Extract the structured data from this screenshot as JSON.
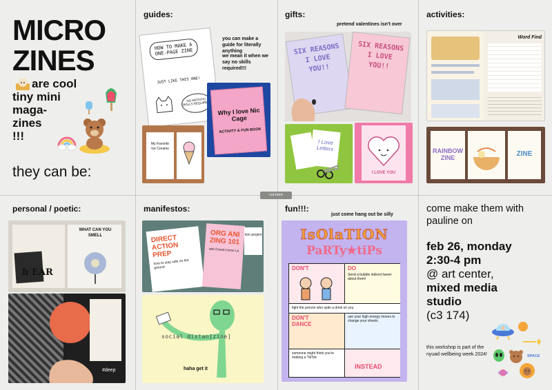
{
  "panels": {
    "title": {
      "headline_line1": "MICRO",
      "headline_line2": "ZINES",
      "line_a": "are cool",
      "line_b": "tiny mini",
      "line_c": "maga-",
      "line_d": "zines",
      "line_e": "!!!",
      "they_can_be": "they can be:"
    },
    "guides": {
      "title": "guides:",
      "note_line1": "you can make a guide for literally anything",
      "note_line2": "we mean it when we say no skills required!!!",
      "zine1_title": "HOW TO MAKE A ONE-PAGE ZINE",
      "zine1_sub": "JUST LIKE THIS ONE!",
      "zine1_bubble": "NO ARTISTIC SKILLS REQUIRED!",
      "zine2_title": "Why I love Nic Cage",
      "zine2_sub": "ACTIVITY & FUN BOOK",
      "zine3_title": "My Favorite Ice Creams"
    },
    "gifts": {
      "title": "gifts:",
      "note": "pretend valentines isn't over",
      "zine_text": "SIX REASONS I LOVE YOU!!",
      "zine2_text": "I Love Letters",
      "zine3_text": "I LOVE YOU"
    },
    "activities": {
      "title": "activities:",
      "wordfind": "Word Find",
      "zine_label1": "RAINBOW ZINE",
      "zine_label2": "ZINE"
    },
    "personal": {
      "title": "personal / poetic:",
      "collage_text1": "WHAT CAN YOU SMELL",
      "collage_text2": "h EAR",
      "hashtag": "#deep"
    },
    "manifestos": {
      "title": "manifestos:",
      "zine1_title": "DIRECT ACTION PREP",
      "zine1_sub": "how to stay safe on the ground",
      "zine2_title": "ORG ANI ZING 101",
      "zine2_sub": "with Crowd Cmmo LA",
      "zine3_title": "rion project",
      "social": "social distan[zine]",
      "caption": "haha get it"
    },
    "fun": {
      "title": "fun!!!:",
      "note": "just come hang out be silly",
      "poster_line1": "IsOlaTION",
      "poster_line2": "PaRTy★tiPs",
      "cell_dont1": "DON'T",
      "cell_do": "DO",
      "cell_do_text": "Send a bubble indirect tweet about them!",
      "cell_fight": "fight the person who spits a drink on you",
      "cell_dont2": "DON'T DANCE",
      "cell_energy": "use your high energy moves to change your sheets",
      "cell_someone": "someone might think you're making a TikTok",
      "cell_instead": "INSTEAD"
    },
    "event": {
      "come_line": "come make them with pauline on",
      "date": "feb 26, monday",
      "time": "2:30-4 pm",
      "at": "@ art center,",
      "venue1": "mixed media",
      "venue2": "studio",
      "room": "(c3 174)",
      "workshop": "this workshop is part of the nyuad wellbeing week 2024!",
      "space_label": "SPACE"
    }
  },
  "cut_label": "cut here",
  "colors": {
    "paper": "#eeeeec",
    "pink": "#f4a6c8",
    "lavender": "#b9a8e6",
    "poster_purple": "#c3b3ee",
    "mint": "#7fd690",
    "yellow_bg": "#fbf6c6",
    "green_bg": "#90c63f",
    "blue_cover": "#1d47a0",
    "hot_pink": "#f07aa8"
  }
}
